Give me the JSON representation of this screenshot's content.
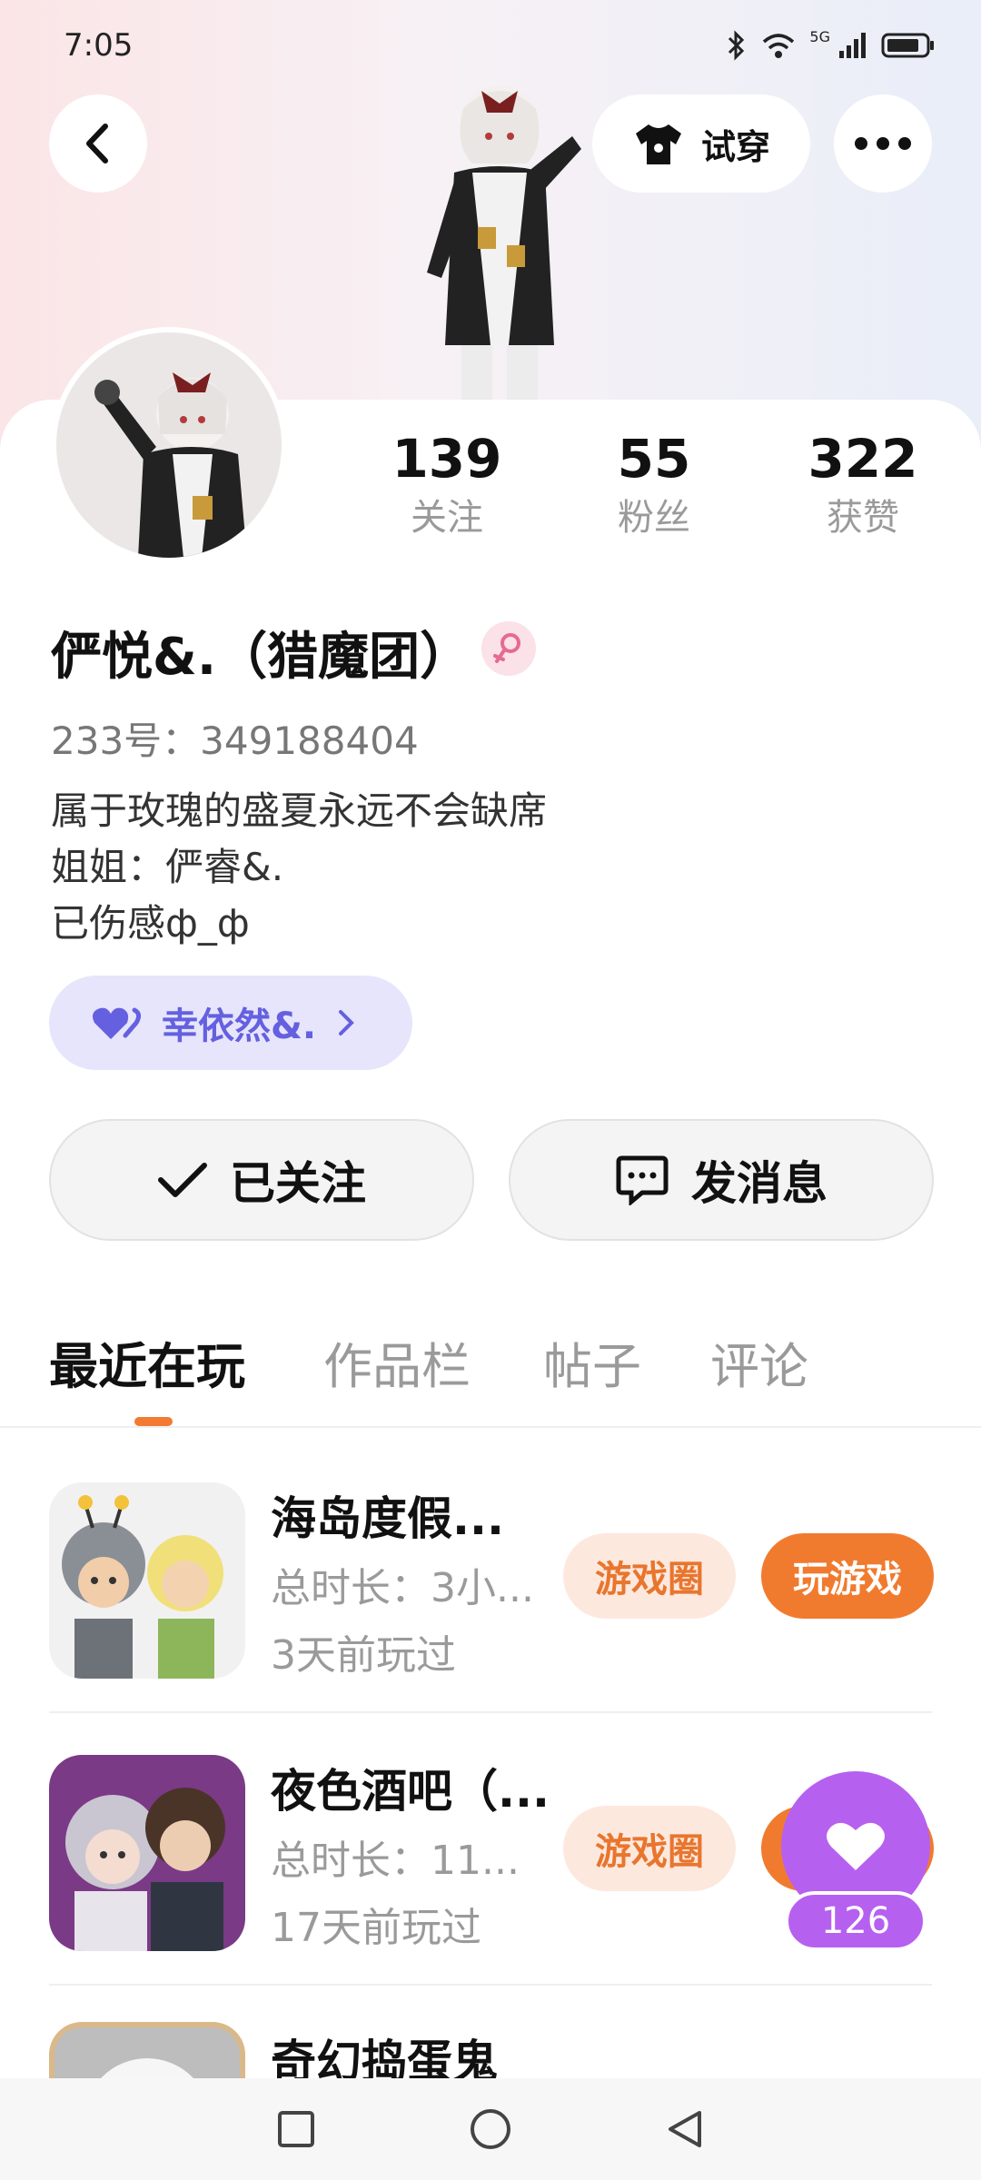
{
  "status_bar": {
    "time": "7:05",
    "network": "5G"
  },
  "header": {
    "back_icon": "chevron-left-icon",
    "tryon_label": "试穿",
    "more_icon": "more-horizontal-icon"
  },
  "profile": {
    "nickname": "俨悦&.（猎魔团）",
    "gender_icon": "female-icon",
    "user_id": "233号：349188404",
    "bio_lines": [
      "属于玫瑰的盛夏永远不会缺席",
      "姐姐：俨睿&.",
      "已伤感ф_ф"
    ],
    "cp_tag": "幸依然&.",
    "stats": {
      "following": {
        "value": "139",
        "label": "关注"
      },
      "fans": {
        "value": "55",
        "label": "粉丝"
      },
      "likes": {
        "value": "322",
        "label": "获赞"
      }
    }
  },
  "actions": {
    "follow_label": "已关注",
    "message_label": "发消息"
  },
  "tabs": [
    {
      "label": "最近在玩",
      "active": true
    },
    {
      "label": "作品栏",
      "active": false
    },
    {
      "label": "帖子",
      "active": false
    },
    {
      "label": "评论",
      "active": false
    }
  ],
  "games": [
    {
      "title": "海岛度假...",
      "duration": "总时长：3小...",
      "last_played": "3天前玩过",
      "circle_label": "游戏圈",
      "play_label": "玩游戏"
    },
    {
      "title": "夜色酒吧（...",
      "duration": "总时长：11...",
      "last_played": "17天前玩过",
      "circle_label": "游戏圈",
      "play_label": "玩游戏"
    },
    {
      "title": "奇幻捣蛋鬼"
    }
  ],
  "like_fab": {
    "count": "126"
  },
  "colors": {
    "accent": "#f07b2f",
    "cp_purple": "#6460e0",
    "fab_purple": "#b660f0"
  }
}
